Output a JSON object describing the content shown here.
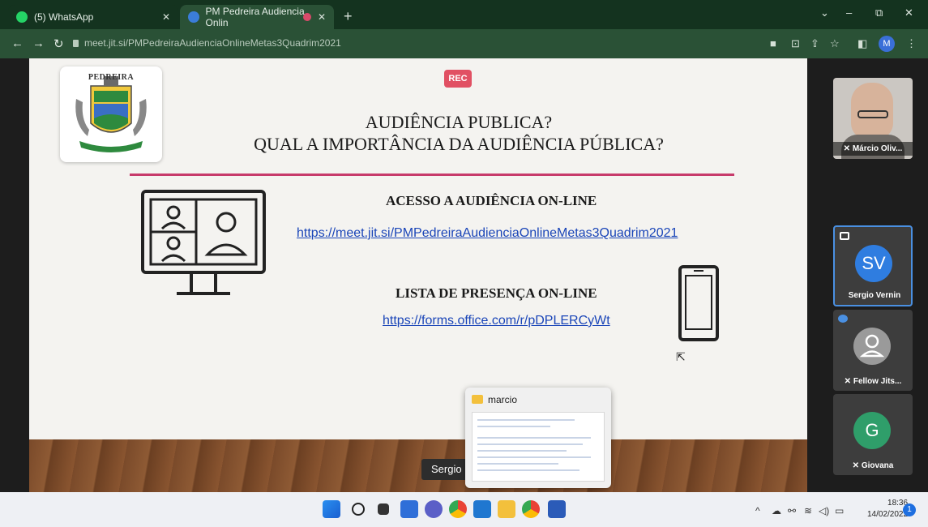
{
  "browser": {
    "tabs": [
      {
        "label": "(5) WhatsApp",
        "active": false,
        "favicon_color": "#25d366"
      },
      {
        "label": "PM Pedreira Audiencia Onlin",
        "active": true,
        "favicon_color": "#3b7dd8"
      }
    ],
    "url": "meet.jit.si/PMPedreiraAudienciaOnlineMetas3Quadrim2021",
    "profile_initial": "M",
    "new_tab_label": "+",
    "window_controls": [
      "⌄",
      "–",
      "⧉",
      "✕"
    ]
  },
  "slide": {
    "logo_name": "PEDREIRA",
    "rec_label": "REC",
    "title_line1": "AUDIÊNCIA PUBLICA?",
    "title_line2": "QUAL A IMPORTÂNCIA DA AUDIÊNCIA PÚBLICA?",
    "access_heading": "ACESSO A AUDIÊNCIA ON-LINE",
    "access_link": "https://meet.jit.si/PMPedreiraAudienciaOnlineMetas3Quadrim2021",
    "attendance_heading": "LISTA DE PRESENÇA ON-LINE",
    "attendance_link": "https://forms.office.com/r/pDPLERCyWt",
    "accent_color": "#c73a6b"
  },
  "presenter_label": "Sergio",
  "popup": {
    "title": "marcio"
  },
  "participants": [
    {
      "name": "Márcio Oliv...",
      "type": "video"
    },
    {
      "name": "Sergio Vernin",
      "initials": "SV",
      "color": "#2f7de0",
      "type": "avatar"
    },
    {
      "name": "Fellow Jits...",
      "type": "guest"
    },
    {
      "name": "Giovana",
      "initials": "G",
      "color": "#2f9e6a",
      "type": "avatar"
    }
  ],
  "taskbar": {
    "time": "18:36",
    "date": "14/02/2022",
    "notification_count": "1"
  }
}
